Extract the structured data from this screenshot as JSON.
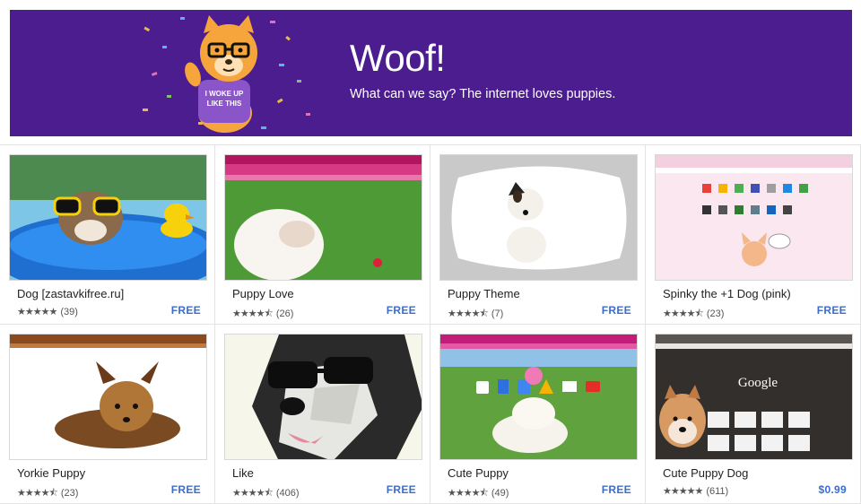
{
  "banner": {
    "title": "Woof!",
    "subtitle": "What can we say? The internet loves puppies.",
    "shirt_line1": "I WOKE UP",
    "shirt_line2": "LIKE THIS",
    "colors": {
      "background": "#4b1d8f",
      "dog": "#f6a53c"
    }
  },
  "items": [
    {
      "title": "Dog [zastavkifree.ru]",
      "stars": "★★★★★",
      "count": "(39)",
      "price": "FREE"
    },
    {
      "title": "Puppy Love",
      "stars": "★★★★⯪",
      "count": "(26)",
      "price": "FREE"
    },
    {
      "title": "Puppy Theme",
      "stars": "★★★★⯪",
      "count": "(7)",
      "price": "FREE"
    },
    {
      "title": "Spinky the +1 Dog (pink)",
      "stars": "★★★★⯪",
      "count": "(23)",
      "price": "FREE"
    },
    {
      "title": "Yorkie Puppy",
      "stars": "★★★★⯪",
      "count": "(23)",
      "price": "FREE"
    },
    {
      "title": "Like",
      "stars": "★★★★⯪",
      "count": "(406)",
      "price": "FREE"
    },
    {
      "title": "Cute Puppy",
      "stars": "★★★★⯪",
      "count": "(49)",
      "price": "FREE"
    },
    {
      "title": "Cute Puppy Dog",
      "stars": "★★★★★",
      "count": "(611)",
      "price": "$0.99"
    }
  ],
  "thumb_text": {
    "google_logo": "Google"
  },
  "colors": {
    "price": "#3d6dcc",
    "card_bg": "#ffffff",
    "page_bg": "#f2f2f2"
  }
}
